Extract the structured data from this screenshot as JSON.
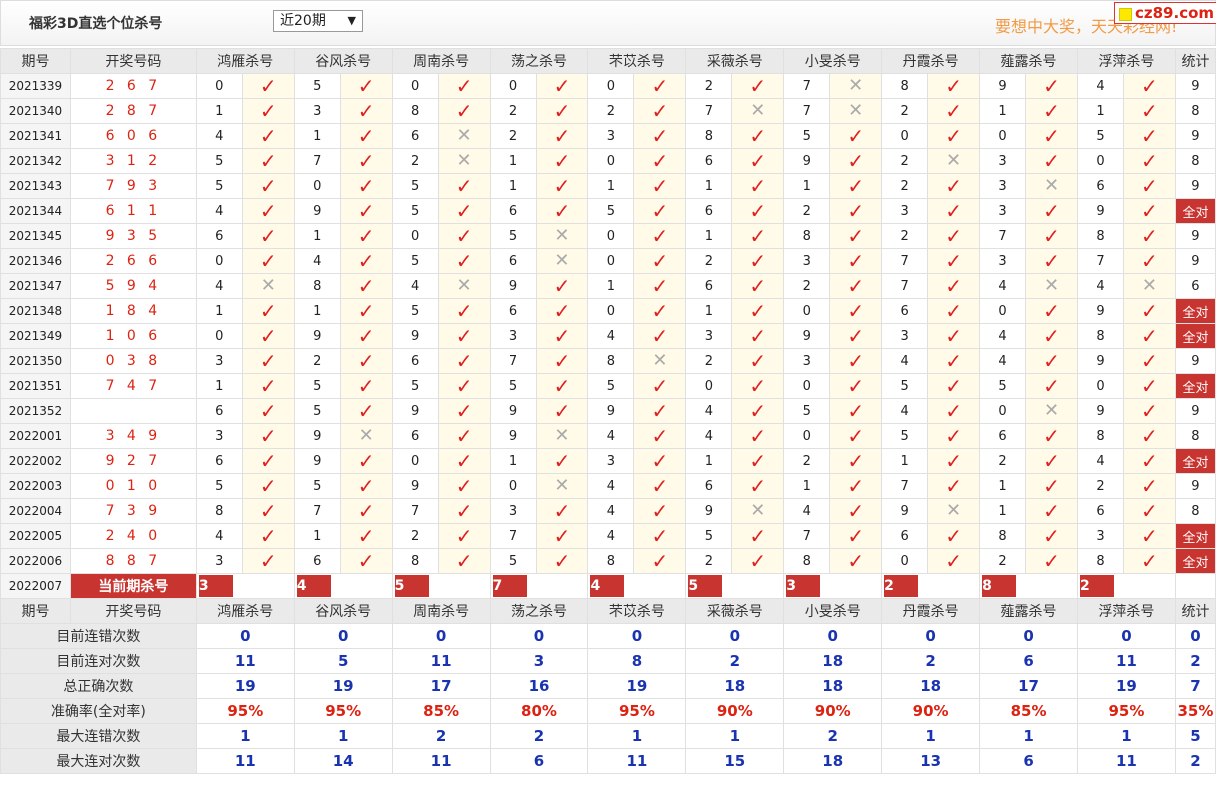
{
  "title": "福彩3D直选个位杀号",
  "period_select": {
    "value": "近20期",
    "arrow": "▼"
  },
  "slogan": "要想中大奖，天天彩经网!",
  "logo": "cz89.com",
  "headers": [
    "期号",
    "开奖号码",
    "鸿雁杀号",
    "谷风杀号",
    "周南杀号",
    "荡之杀号",
    "芣苡杀号",
    "采薇杀号",
    "小旻杀号",
    "丹霞杀号",
    "薤露杀号",
    "浮萍杀号",
    "统计"
  ],
  "marks": {
    "hit": "✓",
    "miss": "✕"
  },
  "rows": [
    {
      "p": "2021339",
      "d": "2 6 7",
      "k": [
        [
          0,
          1
        ],
        [
          5,
          1
        ],
        [
          0,
          1
        ],
        [
          0,
          1
        ],
        [
          0,
          1
        ],
        [
          2,
          1
        ],
        [
          7,
          0
        ],
        [
          8,
          1
        ],
        [
          9,
          1
        ],
        [
          4,
          1
        ]
      ],
      "s": "9"
    },
    {
      "p": "2021340",
      "d": "2 8 7",
      "k": [
        [
          1,
          1
        ],
        [
          3,
          1
        ],
        [
          8,
          1
        ],
        [
          2,
          1
        ],
        [
          2,
          1
        ],
        [
          7,
          0
        ],
        [
          7,
          0
        ],
        [
          2,
          1
        ],
        [
          1,
          1
        ],
        [
          1,
          1
        ]
      ],
      "s": "8"
    },
    {
      "p": "2021341",
      "d": "6 0 6",
      "k": [
        [
          4,
          1
        ],
        [
          1,
          1
        ],
        [
          6,
          0
        ],
        [
          2,
          1
        ],
        [
          3,
          1
        ],
        [
          8,
          1
        ],
        [
          5,
          1
        ],
        [
          0,
          1
        ],
        [
          0,
          1
        ],
        [
          5,
          1
        ]
      ],
      "s": "9"
    },
    {
      "p": "2021342",
      "d": "3 1 2",
      "k": [
        [
          5,
          1
        ],
        [
          7,
          1
        ],
        [
          2,
          0
        ],
        [
          1,
          1
        ],
        [
          0,
          1
        ],
        [
          6,
          1
        ],
        [
          9,
          1
        ],
        [
          2,
          0
        ],
        [
          3,
          1
        ],
        [
          0,
          1
        ]
      ],
      "s": "8"
    },
    {
      "p": "2021343",
      "d": "7 9 3",
      "k": [
        [
          5,
          1
        ],
        [
          0,
          1
        ],
        [
          5,
          1
        ],
        [
          1,
          1
        ],
        [
          1,
          1
        ],
        [
          1,
          1
        ],
        [
          1,
          1
        ],
        [
          2,
          1
        ],
        [
          3,
          0
        ],
        [
          6,
          1
        ]
      ],
      "s": "9"
    },
    {
      "p": "2021344",
      "d": "6 1 1",
      "k": [
        [
          4,
          1
        ],
        [
          9,
          1
        ],
        [
          5,
          1
        ],
        [
          6,
          1
        ],
        [
          5,
          1
        ],
        [
          6,
          1
        ],
        [
          2,
          1
        ],
        [
          3,
          1
        ],
        [
          3,
          1
        ],
        [
          9,
          1
        ]
      ],
      "s": "全对"
    },
    {
      "p": "2021345",
      "d": "9 3 5",
      "k": [
        [
          6,
          1
        ],
        [
          1,
          1
        ],
        [
          0,
          1
        ],
        [
          5,
          0
        ],
        [
          0,
          1
        ],
        [
          1,
          1
        ],
        [
          8,
          1
        ],
        [
          2,
          1
        ],
        [
          7,
          1
        ],
        [
          8,
          1
        ]
      ],
      "s": "9"
    },
    {
      "p": "2021346",
      "d": "2 6 6",
      "k": [
        [
          0,
          1
        ],
        [
          4,
          1
        ],
        [
          5,
          1
        ],
        [
          6,
          0
        ],
        [
          0,
          1
        ],
        [
          2,
          1
        ],
        [
          3,
          1
        ],
        [
          7,
          1
        ],
        [
          3,
          1
        ],
        [
          7,
          1
        ]
      ],
      "s": "9"
    },
    {
      "p": "2021347",
      "d": "5 9 4",
      "k": [
        [
          4,
          0
        ],
        [
          8,
          1
        ],
        [
          4,
          0
        ],
        [
          9,
          1
        ],
        [
          1,
          1
        ],
        [
          6,
          1
        ],
        [
          2,
          1
        ],
        [
          7,
          1
        ],
        [
          4,
          0
        ],
        [
          4,
          0
        ]
      ],
      "s": "6"
    },
    {
      "p": "2021348",
      "d": "1 8 4",
      "k": [
        [
          1,
          1
        ],
        [
          1,
          1
        ],
        [
          5,
          1
        ],
        [
          6,
          1
        ],
        [
          0,
          1
        ],
        [
          1,
          1
        ],
        [
          0,
          1
        ],
        [
          6,
          1
        ],
        [
          0,
          1
        ],
        [
          9,
          1
        ]
      ],
      "s": "全对"
    },
    {
      "p": "2021349",
      "d": "1 0 6",
      "k": [
        [
          0,
          1
        ],
        [
          9,
          1
        ],
        [
          9,
          1
        ],
        [
          3,
          1
        ],
        [
          4,
          1
        ],
        [
          3,
          1
        ],
        [
          9,
          1
        ],
        [
          3,
          1
        ],
        [
          4,
          1
        ],
        [
          8,
          1
        ]
      ],
      "s": "全对"
    },
    {
      "p": "2021350",
      "d": "0 3 8",
      "k": [
        [
          3,
          1
        ],
        [
          2,
          1
        ],
        [
          6,
          1
        ],
        [
          7,
          1
        ],
        [
          8,
          0
        ],
        [
          2,
          1
        ],
        [
          3,
          1
        ],
        [
          4,
          1
        ],
        [
          4,
          1
        ],
        [
          9,
          1
        ]
      ],
      "s": "9"
    },
    {
      "p": "2021351",
      "d": "7 4 7",
      "k": [
        [
          1,
          1
        ],
        [
          5,
          1
        ],
        [
          5,
          1
        ],
        [
          5,
          1
        ],
        [
          5,
          1
        ],
        [
          0,
          1
        ],
        [
          0,
          1
        ],
        [
          5,
          1
        ],
        [
          5,
          1
        ],
        [
          0,
          1
        ]
      ],
      "s": "全对"
    },
    {
      "p": "2021352",
      "d": "",
      "k": [
        [
          6,
          1
        ],
        [
          5,
          1
        ],
        [
          9,
          1
        ],
        [
          9,
          1
        ],
        [
          9,
          1
        ],
        [
          4,
          1
        ],
        [
          5,
          1
        ],
        [
          4,
          1
        ],
        [
          0,
          0
        ],
        [
          9,
          1
        ]
      ],
      "s": "9"
    },
    {
      "p": "2022001",
      "d": "3 4 9",
      "k": [
        [
          3,
          1
        ],
        [
          9,
          0
        ],
        [
          6,
          1
        ],
        [
          9,
          0
        ],
        [
          4,
          1
        ],
        [
          4,
          1
        ],
        [
          0,
          1
        ],
        [
          5,
          1
        ],
        [
          6,
          1
        ],
        [
          8,
          1
        ]
      ],
      "s": "8"
    },
    {
      "p": "2022002",
      "d": "9 2 7",
      "k": [
        [
          6,
          1
        ],
        [
          9,
          1
        ],
        [
          0,
          1
        ],
        [
          1,
          1
        ],
        [
          3,
          1
        ],
        [
          1,
          1
        ],
        [
          2,
          1
        ],
        [
          1,
          1
        ],
        [
          2,
          1
        ],
        [
          4,
          1
        ]
      ],
      "s": "全对"
    },
    {
      "p": "2022003",
      "d": "0 1 0",
      "k": [
        [
          5,
          1
        ],
        [
          5,
          1
        ],
        [
          9,
          1
        ],
        [
          0,
          0
        ],
        [
          4,
          1
        ],
        [
          6,
          1
        ],
        [
          1,
          1
        ],
        [
          7,
          1
        ],
        [
          1,
          1
        ],
        [
          2,
          1
        ]
      ],
      "s": "9"
    },
    {
      "p": "2022004",
      "d": "7 3 9",
      "k": [
        [
          8,
          1
        ],
        [
          7,
          1
        ],
        [
          7,
          1
        ],
        [
          3,
          1
        ],
        [
          4,
          1
        ],
        [
          9,
          0
        ],
        [
          4,
          1
        ],
        [
          9,
          0
        ],
        [
          1,
          1
        ],
        [
          6,
          1
        ]
      ],
      "s": "8"
    },
    {
      "p": "2022005",
      "d": "2 4 0",
      "k": [
        [
          4,
          1
        ],
        [
          1,
          1
        ],
        [
          2,
          1
        ],
        [
          7,
          1
        ],
        [
          4,
          1
        ],
        [
          5,
          1
        ],
        [
          7,
          1
        ],
        [
          6,
          1
        ],
        [
          8,
          1
        ],
        [
          3,
          1
        ]
      ],
      "s": "全对"
    },
    {
      "p": "2022006",
      "d": "8 8 7",
      "k": [
        [
          3,
          1
        ],
        [
          6,
          1
        ],
        [
          8,
          1
        ],
        [
          5,
          1
        ],
        [
          8,
          1
        ],
        [
          2,
          1
        ],
        [
          8,
          1
        ],
        [
          0,
          1
        ],
        [
          2,
          1
        ],
        [
          8,
          1
        ]
      ],
      "s": "全对"
    }
  ],
  "current": {
    "period": "2022007",
    "label": "当前期杀号",
    "kills": [
      "3",
      "4",
      "5",
      "7",
      "4",
      "5",
      "3",
      "2",
      "8",
      "2"
    ]
  },
  "stats": [
    {
      "label": "目前连错次数",
      "values": [
        "0",
        "0",
        "0",
        "0",
        "0",
        "0",
        "0",
        "0",
        "0",
        "0",
        "0"
      ]
    },
    {
      "label": "目前连对次数",
      "values": [
        "11",
        "5",
        "11",
        "3",
        "8",
        "2",
        "18",
        "2",
        "6",
        "11",
        "2"
      ]
    },
    {
      "label": "总正确次数",
      "values": [
        "19",
        "19",
        "17",
        "16",
        "19",
        "18",
        "18",
        "18",
        "17",
        "19",
        "7"
      ]
    },
    {
      "label": "准确率(全对率)",
      "values": [
        "95%",
        "95%",
        "85%",
        "80%",
        "95%",
        "90%",
        "90%",
        "90%",
        "85%",
        "95%",
        "35%"
      ],
      "red": true
    },
    {
      "label": "最大连错次数",
      "values": [
        "1",
        "1",
        "2",
        "2",
        "1",
        "1",
        "2",
        "1",
        "1",
        "1",
        "5"
      ]
    },
    {
      "label": "最大连对次数",
      "values": [
        "11",
        "14",
        "11",
        "6",
        "11",
        "15",
        "18",
        "13",
        "6",
        "11",
        "2"
      ]
    }
  ],
  "colors": {
    "accent_red": "#c83430",
    "check_red": "#e02020",
    "stat_blue": "#1a33b0",
    "slogan_orange": "#f29b46"
  }
}
